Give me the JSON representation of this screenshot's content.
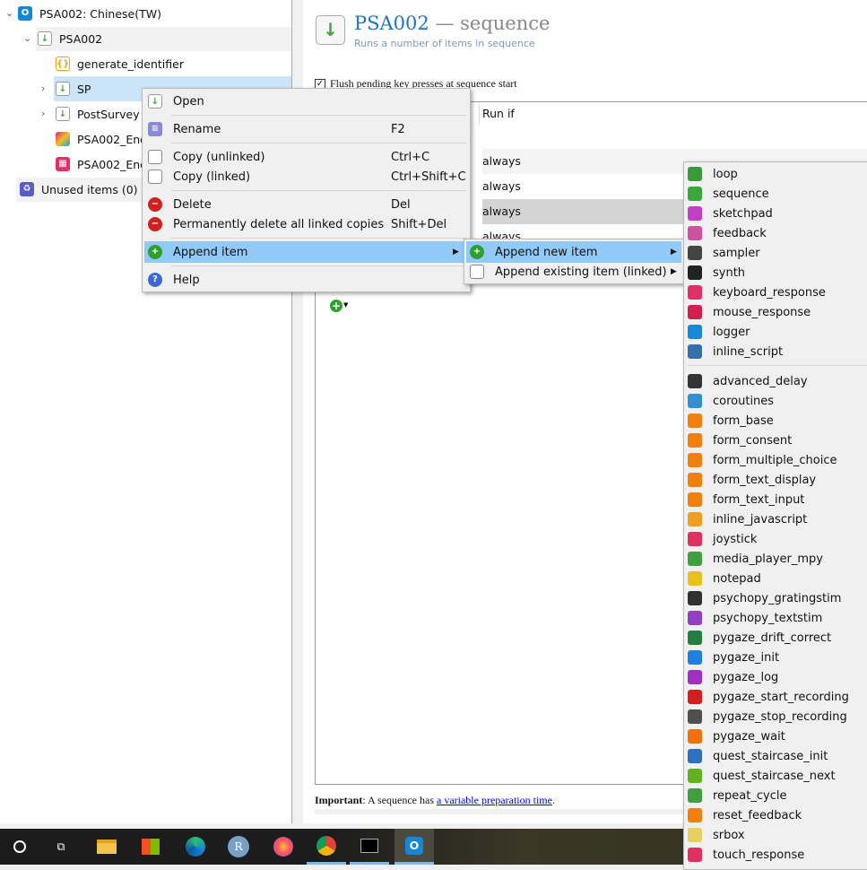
{
  "tree": {
    "items": [
      {
        "label": "PSA002: Chinese(TW)",
        "icon": "opensesame-icon",
        "color": "#1487d9"
      },
      {
        "label": "PSA002",
        "icon": "sequence-icon",
        "color": "#3aa73a"
      },
      {
        "label": "generate_identifier",
        "icon": "inline-javascript-icon",
        "color": "#f0a020"
      },
      {
        "label": "SP",
        "icon": "sequence-icon",
        "color": "#3aa73a"
      },
      {
        "label": "PostSurvey",
        "icon": "sequence-icon",
        "color": "#3aa73a"
      },
      {
        "label": "PSA002_End",
        "icon": "sketchpad-icon",
        "color": "#c040c0"
      },
      {
        "label": "PSA002_End_",
        "icon": "keyboard-response-icon",
        "color": "#e0306a"
      },
      {
        "label": "Unused items (0)",
        "icon": "recycle-icon",
        "color": "#5a5ac8"
      }
    ]
  },
  "header": {
    "title": "PSA002",
    "title_suffix": "— sequence",
    "subtitle": "Runs a number of items in sequence"
  },
  "flush_label": "Flush pending key presses at sequence start",
  "table": {
    "column": "Run if",
    "rows": [
      "always",
      "always",
      "always",
      "always"
    ]
  },
  "footer": {
    "bold": "Important",
    "text": ": A sequence has ",
    "link": "a variable preparation time",
    "end": "."
  },
  "context_menu": [
    {
      "label": "Open",
      "shortcut": "",
      "icon": "open-icon"
    },
    {
      "label": "Rename",
      "shortcut": "F2",
      "icon": "rename-icon"
    },
    {
      "label": "Copy (unlinked)",
      "shortcut": "Ctrl+C",
      "icon": "copy-icon"
    },
    {
      "label": "Copy (linked)",
      "shortcut": "Ctrl+Shift+C",
      "icon": "copy-icon"
    },
    {
      "label": "Delete",
      "shortcut": "Del",
      "icon": "delete-icon"
    },
    {
      "label": "Permanently delete all linked copies",
      "shortcut": "Shift+Del",
      "icon": "delete-icon"
    },
    {
      "label": "Append item",
      "shortcut": "",
      "icon": "add-icon"
    },
    {
      "label": "Help",
      "shortcut": "",
      "icon": "help-icon"
    }
  ],
  "submenu": [
    {
      "label": "Append new item"
    },
    {
      "label": "Append existing item (linked)"
    }
  ],
  "item_types": [
    {
      "label": "loop",
      "color": "#3a9a3a"
    },
    {
      "label": "sequence",
      "color": "#3aa73a"
    },
    {
      "label": "sketchpad",
      "color": "#c040c0"
    },
    {
      "label": "feedback",
      "color": "#d050a0"
    },
    {
      "label": "sampler",
      "color": "#444444"
    },
    {
      "label": "synth",
      "color": "#222222"
    },
    {
      "label": "keyboard_response",
      "color": "#e0306a"
    },
    {
      "label": "mouse_response",
      "color": "#d02050"
    },
    {
      "label": "logger",
      "color": "#1a88d8"
    },
    {
      "label": "inline_script",
      "color": "#3670a8"
    },
    {
      "label": "advanced_delay",
      "color": "#333333"
    },
    {
      "label": "coroutines",
      "color": "#3090d0"
    },
    {
      "label": "form_base",
      "color": "#f08010"
    },
    {
      "label": "form_consent",
      "color": "#f08010"
    },
    {
      "label": "form_multiple_choice",
      "color": "#f08010"
    },
    {
      "label": "form_text_display",
      "color": "#f08010"
    },
    {
      "label": "form_text_input",
      "color": "#f08010"
    },
    {
      "label": "inline_javascript",
      "color": "#f0a020"
    },
    {
      "label": "joystick",
      "color": "#e03060"
    },
    {
      "label": "media_player_mpy",
      "color": "#40a040"
    },
    {
      "label": "notepad",
      "color": "#e8c020"
    },
    {
      "label": "psychopy_gratingstim",
      "color": "#303030"
    },
    {
      "label": "psychopy_textstim",
      "color": "#9040c0"
    },
    {
      "label": "pygaze_drift_correct",
      "color": "#208040"
    },
    {
      "label": "pygaze_init",
      "color": "#2080e0"
    },
    {
      "label": "pygaze_log",
      "color": "#a030c0"
    },
    {
      "label": "pygaze_start_recording",
      "color": "#d02020"
    },
    {
      "label": "pygaze_stop_recording",
      "color": "#505050"
    },
    {
      "label": "pygaze_wait",
      "color": "#f07010"
    },
    {
      "label": "quest_staircase_init",
      "color": "#3070c0"
    },
    {
      "label": "quest_staircase_next",
      "color": "#60b020"
    },
    {
      "label": "repeat_cycle",
      "color": "#40a040"
    },
    {
      "label": "reset_feedback",
      "color": "#f08010"
    },
    {
      "label": "srbox",
      "color": "#e8d060"
    },
    {
      "label": "touch_response",
      "color": "#e03060"
    }
  ],
  "taskbar": [
    {
      "icon": "cortana-icon"
    },
    {
      "icon": "task-view-icon"
    },
    {
      "icon": "file-explorer-icon"
    },
    {
      "icon": "store-icon"
    },
    {
      "icon": "edge-icon"
    },
    {
      "icon": "r-icon"
    },
    {
      "icon": "firefox-icon"
    },
    {
      "icon": "chrome-icon"
    },
    {
      "icon": "terminal-icon"
    },
    {
      "icon": "opensesame-icon"
    }
  ]
}
